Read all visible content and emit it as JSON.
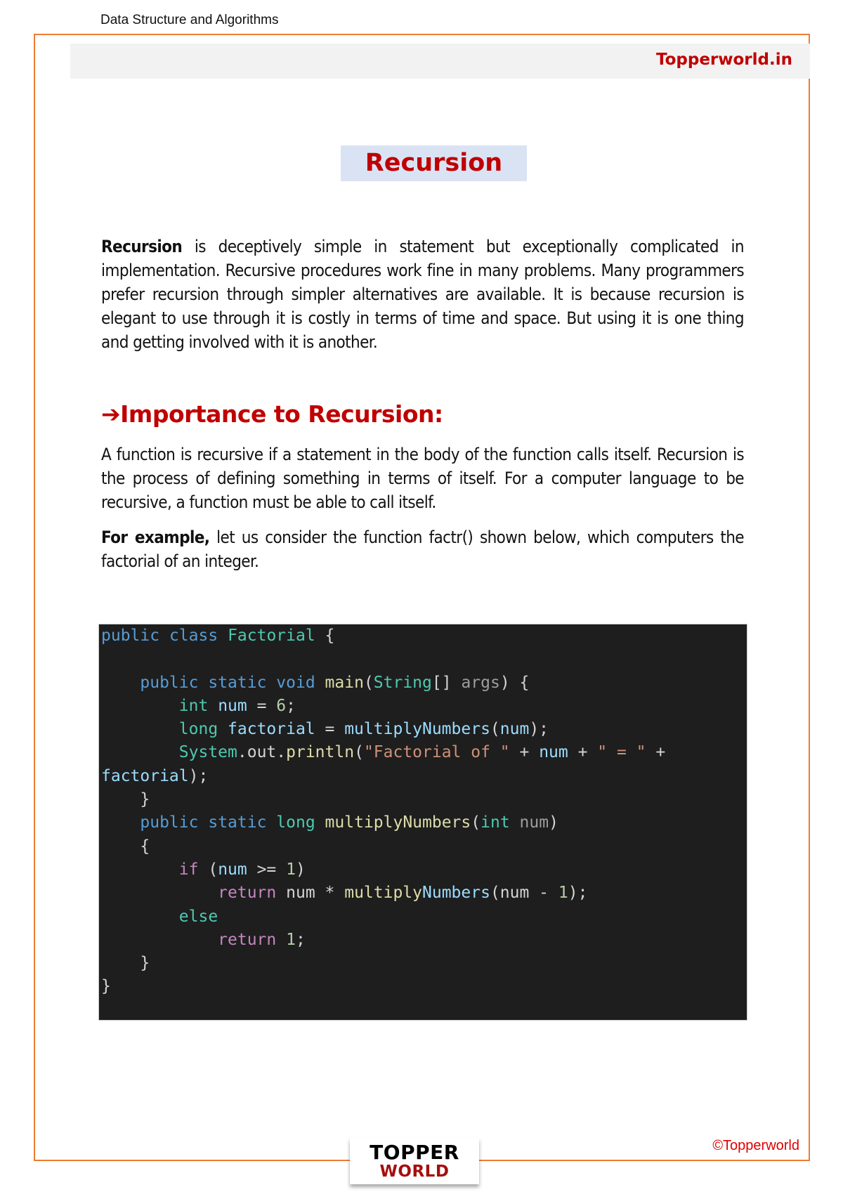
{
  "header": {
    "running_title": "Data Structure and Algorithms",
    "site_name": "Topperworld.in"
  },
  "page": {
    "title": "Recursion",
    "intro": {
      "bold_lead": "Recursion",
      "text": " is deceptively simple in statement but exceptionally complicated in implementation. Recursive procedures work fine in many problems. Many programmers prefer recursion through simpler alternatives are available. It is because recursion is elegant to use through it is costly in terms of time and space. But using it is one thing and getting involved with it is another."
    },
    "section": {
      "arrow": "➔",
      "heading": "Importance to Recursion:",
      "paragraph": "A function is recursive if a statement in the body of the function calls itself. Recursion is the process of defining something in terms of itself. For a computer language to be recursive, a function must be able to call itself.",
      "example_lead": "For example,",
      "example_text": " let us consider the function factr() shown below, which computers the factorial of an integer."
    }
  },
  "code": {
    "language": "java",
    "lines": [
      [
        [
          "kw",
          "public"
        ],
        [
          "pl",
          " "
        ],
        [
          "kw",
          "class"
        ],
        [
          "pl",
          " "
        ],
        [
          "ty",
          "Factorial"
        ],
        [
          "pl",
          " {"
        ]
      ],
      [],
      [
        [
          "pl",
          "    "
        ],
        [
          "kw",
          "public"
        ],
        [
          "pl",
          " "
        ],
        [
          "kw",
          "static"
        ],
        [
          "pl",
          " "
        ],
        [
          "kw",
          "void"
        ],
        [
          "pl",
          " "
        ],
        [
          "fn",
          "main"
        ],
        [
          "pl",
          "("
        ],
        [
          "ty",
          "String"
        ],
        [
          "pl",
          "[] "
        ],
        [
          "dim",
          "args"
        ],
        [
          "pl",
          ") {"
        ]
      ],
      [
        [
          "pl",
          "        "
        ],
        [
          "ty",
          "int"
        ],
        [
          "pl",
          " "
        ],
        [
          "var",
          "num"
        ],
        [
          "pl",
          " = "
        ],
        [
          "num",
          "6"
        ],
        [
          "pl",
          ";"
        ]
      ],
      [
        [
          "pl",
          "        "
        ],
        [
          "ty",
          "long"
        ],
        [
          "pl",
          " "
        ],
        [
          "var",
          "factorial"
        ],
        [
          "pl",
          " = "
        ],
        [
          "var",
          "multiplyNumbers"
        ],
        [
          "pl",
          "("
        ],
        [
          "var",
          "num"
        ],
        [
          "pl",
          ");"
        ]
      ],
      [
        [
          "pl",
          "        "
        ],
        [
          "ty",
          "System"
        ],
        [
          "pl",
          "."
        ],
        [
          "pl",
          "out"
        ],
        [
          "pl",
          "."
        ],
        [
          "fn",
          "println"
        ],
        [
          "pl",
          "("
        ],
        [
          "str",
          "\"Factorial of \""
        ],
        [
          "pl",
          " + "
        ],
        [
          "var",
          "num"
        ],
        [
          "pl",
          " + "
        ],
        [
          "str",
          "\" = \""
        ],
        [
          "pl",
          " +"
        ]
      ],
      [
        [
          "var",
          "factorial"
        ],
        [
          "pl",
          ");"
        ]
      ],
      [
        [
          "pl",
          "    }"
        ]
      ],
      [
        [
          "pl",
          "    "
        ],
        [
          "kw",
          "public"
        ],
        [
          "pl",
          " "
        ],
        [
          "kw",
          "static"
        ],
        [
          "pl",
          " "
        ],
        [
          "ty",
          "long"
        ],
        [
          "pl",
          " "
        ],
        [
          "fn",
          "multiplyNumbers"
        ],
        [
          "pl",
          "("
        ],
        [
          "ty",
          "int"
        ],
        [
          "pl",
          " "
        ],
        [
          "dim",
          "num"
        ],
        [
          "pl",
          ")"
        ]
      ],
      [
        [
          "pl",
          "    {"
        ]
      ],
      [
        [
          "pl",
          "        "
        ],
        [
          "ctl",
          "if"
        ],
        [
          "pl",
          " ("
        ],
        [
          "var",
          "num"
        ],
        [
          "pl",
          " >= "
        ],
        [
          "num",
          "1"
        ],
        [
          "pl",
          ")"
        ]
      ],
      [
        [
          "pl",
          "            "
        ],
        [
          "ctl",
          "return"
        ],
        [
          "pl",
          " "
        ],
        [
          "pl",
          "num"
        ],
        [
          "pl",
          " * "
        ],
        [
          "fn",
          "multiply"
        ],
        [
          "var",
          "Numbers"
        ],
        [
          "pl",
          "(num - "
        ],
        [
          "num",
          "1"
        ],
        [
          "pl",
          ");"
        ]
      ],
      [
        [
          "pl",
          "        "
        ],
        [
          "ty",
          "else"
        ]
      ],
      [
        [
          "pl",
          "            "
        ],
        [
          "ctl",
          "return"
        ],
        [
          "pl",
          " "
        ],
        [
          "num",
          "1"
        ],
        [
          "pl",
          ";"
        ]
      ],
      [
        [
          "pl",
          "    }"
        ]
      ],
      [
        [
          "pl",
          "}"
        ]
      ]
    ]
  },
  "footer": {
    "logo_top": "TOPPER",
    "logo_bottom": "WORLD",
    "copyright": "©Topperworld"
  },
  "colors": {
    "frame_border": "#ed7d31",
    "accent_red": "#c00000",
    "title_bg": "#dae3f3",
    "banner_bg": "#f2f2f2",
    "code_bg": "#1e1e1e"
  }
}
